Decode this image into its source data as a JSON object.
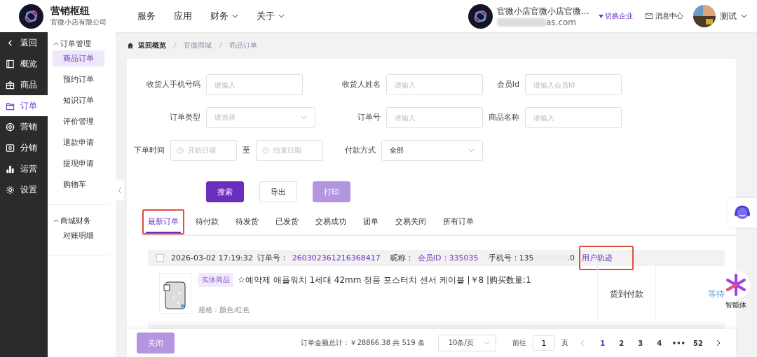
{
  "header": {
    "brand": "营销枢纽",
    "company": "官微小店有限公司",
    "nav": [
      {
        "label": "服务",
        "dropdown": false
      },
      {
        "label": "应用",
        "dropdown": false
      },
      {
        "label": "财务",
        "dropdown": true
      },
      {
        "label": "关于",
        "dropdown": true
      }
    ],
    "shop_name": "官微小店官微小店官微...",
    "shop_email": "as.com",
    "switch": "切换企业",
    "messages": "消息中心",
    "user": "测试"
  },
  "sidebar": {
    "items": [
      {
        "label": "返回",
        "selected": false
      },
      {
        "label": "概览",
        "selected": false
      },
      {
        "label": "商品",
        "selected": false
      },
      {
        "label": "订单",
        "selected": true
      },
      {
        "label": "营销",
        "selected": false
      },
      {
        "label": "分销",
        "selected": false
      },
      {
        "label": "运营",
        "selected": false
      },
      {
        "label": "设置",
        "selected": false
      }
    ]
  },
  "submenu": {
    "groups": [
      {
        "title": "订单管理",
        "expanded": true,
        "items": [
          {
            "label": "商品订单",
            "selected": true
          },
          {
            "label": "预约订单",
            "selected": false
          },
          {
            "label": "知识订单",
            "selected": false
          },
          {
            "label": "评价管理",
            "selected": false
          },
          {
            "label": "退款申请",
            "selected": false
          },
          {
            "label": "提现申请",
            "selected": false
          },
          {
            "label": "购物车",
            "selected": false
          }
        ]
      },
      {
        "title": "商城财务",
        "expanded": true,
        "items": [
          {
            "label": "对账明细",
            "selected": false
          }
        ]
      }
    ]
  },
  "breadcrumb": [
    "返回概览",
    "官微商城",
    "商品订单"
  ],
  "filters": [
    [
      {
        "label": "收货人手机号码",
        "kind": "input",
        "placeholder": "请输入"
      },
      {
        "label": "收货人姓名",
        "kind": "input",
        "placeholder": "请输入"
      },
      {
        "label": "会员Id",
        "kind": "input",
        "placeholder": "请输入会员Id"
      }
    ],
    [
      {
        "label": "订单类型",
        "kind": "select",
        "placeholder": "请选择"
      },
      {
        "label": "订单号",
        "kind": "input",
        "placeholder": "请输入"
      },
      {
        "label": "商品名称",
        "kind": "input",
        "placeholder": "请输入"
      }
    ],
    [
      {
        "label": "下单时间",
        "kind": "daterange",
        "placeholder": "开始日期",
        "to": "至",
        "placeholder_end": "结束日期"
      },
      {
        "label": "付款方式",
        "kind": "select",
        "value": "全部"
      }
    ]
  ],
  "buttons": [
    {
      "label": "搜索",
      "kind": "primary"
    },
    {
      "label": "导出",
      "kind": "plain"
    },
    {
      "label": "打印",
      "kind": "disabled"
    }
  ],
  "tabs": [
    {
      "label": "最新订单",
      "selected": true,
      "highlighted": true
    },
    {
      "label": "待付款",
      "selected": false,
      "highlighted": false
    },
    {
      "label": "待发货",
      "selected": false,
      "highlighted": false
    },
    {
      "label": "已发货",
      "selected": false,
      "highlighted": false
    },
    {
      "label": "交易成功",
      "selected": false,
      "highlighted": false
    },
    {
      "label": "团单",
      "selected": false,
      "highlighted": false
    },
    {
      "label": "交易关闭",
      "selected": false,
      "highlighted": false
    },
    {
      "label": "所有订单",
      "selected": false,
      "highlighted": false
    }
  ],
  "order": {
    "checked": false,
    "time": "2026-03-02 17:19:32",
    "order_no_label": "订单号：",
    "order_no": "260302361216368417",
    "nick_label": "昵称：",
    "member": "会员ID：335035",
    "phone": "手机号：135",
    "phone_end": ".0",
    "track": "用户轨迹",
    "track_highlighted": true,
    "tag": "实体商品",
    "title": "☆예약제 애플워치 1세대 42mm 정품 포스터치 센서 케이블 |￥8 |购买数量:1",
    "spec": "规格：颜色:红色",
    "payment": "货到付款",
    "status": "等待"
  },
  "footer": {
    "close": "关闭",
    "total": "订单金额总计：￥28866.38 共 519 条",
    "page_size": "10条/页",
    "goto": "前往",
    "goto_value": "1",
    "page_unit": "页",
    "pages": [
      {
        "label": "1",
        "selected": true
      },
      {
        "label": "2",
        "selected": false
      },
      {
        "label": "3",
        "selected": false
      },
      {
        "label": "4",
        "selected": false
      },
      {
        "label": "•••",
        "selected": false
      },
      {
        "label": "52",
        "selected": false
      }
    ]
  },
  "assistant": "智能体"
}
